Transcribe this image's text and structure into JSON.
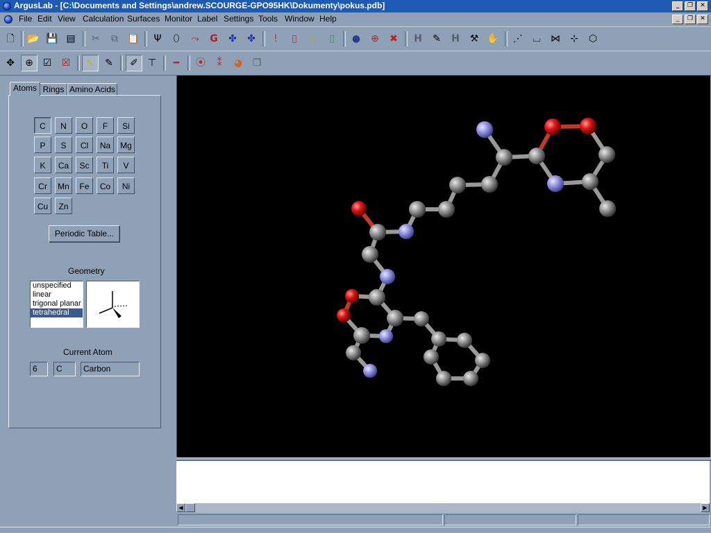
{
  "window": {
    "title": "ArgusLab - [C:\\Documents and Settings\\andrew.SCOURGE-GPO95HK\\Dokumenty\\pokus.pdb]",
    "controls": [
      "_",
      "❐",
      "✕"
    ]
  },
  "menu": [
    "File",
    "Edit",
    "View",
    "Calculation",
    "Surfaces",
    "Monitor",
    "Label",
    "Settings",
    "Tools",
    "Window",
    "Help"
  ],
  "tabs": [
    "Atoms",
    "Rings",
    "Amino Acids"
  ],
  "elements": [
    [
      "C",
      "N",
      "O",
      "F",
      "Si"
    ],
    [
      "P",
      "S",
      "Cl",
      "Na",
      "Mg"
    ],
    [
      "K",
      "Ca",
      "Sc",
      "Ti",
      "V"
    ],
    [
      "Cr",
      "Mn",
      "Fe",
      "Co",
      "Ni"
    ],
    [
      "Cu",
      "Zn"
    ]
  ],
  "selected_element": "C",
  "periodic_button": "Periodic Table...",
  "geometry": {
    "label": "Geometry",
    "options": [
      "unspecified",
      "linear",
      "trigonal planar",
      "tetrahedral"
    ],
    "selected": "tetrahedral"
  },
  "current_atom": {
    "label": "Current Atom",
    "number": "6",
    "symbol": "C",
    "name": "Carbon"
  },
  "colors": {
    "carbon": "#8f8f8f",
    "nitrogen": "#9a9be6",
    "oxygen": "#d81515",
    "bond": "#9a9a9a",
    "viewport_bg": "#000000"
  }
}
